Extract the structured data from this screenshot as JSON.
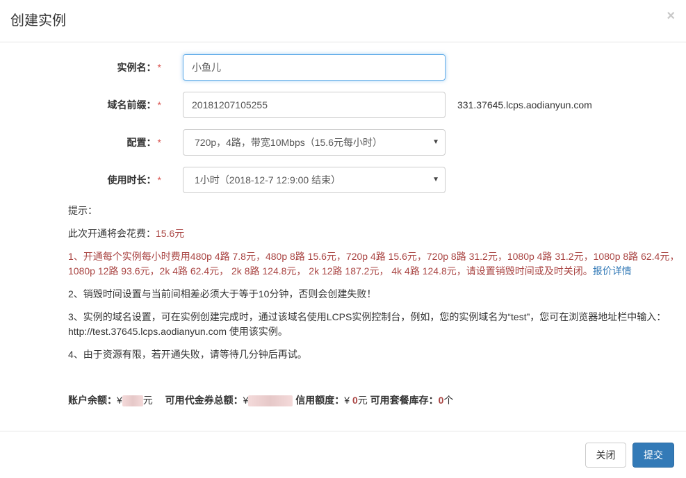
{
  "modal": {
    "title": "创建实例",
    "close_symbol": "×"
  },
  "form": {
    "name": {
      "label": "实例名",
      "colon": "：",
      "required": "*",
      "value": "小鱼儿"
    },
    "domain": {
      "label": "域名前缀",
      "colon": "：",
      "required": "*",
      "value": "20181207105255",
      "suffix": "331.37645.lcps.aodianyun.com"
    },
    "config": {
      "label": "配置",
      "colon": "：",
      "required": "*",
      "selected": "720p，4路，带宽10Mbps（15.6元每小时）"
    },
    "duration": {
      "label": "使用时长",
      "colon": "：",
      "required": "*",
      "selected": "1小时（2018-12-7 12:9:00 结束）"
    }
  },
  "tips": {
    "heading": "提示：",
    "cost_prefix": "此次开通将会花费：",
    "cost_value": "15.6元",
    "item1": "1、开通每个实例每小时费用480p 4路 7.8元，480p 8路 15.6元，720p 4路 15.6元，720p 8路 31.2元，1080p 4路 31.2元，1080p 8路 62.4元，1080p 12路 93.6元，2k 4路 62.4元， 2k 8路 124.8元， 2k 12路 187.2元， 4k 4路 124.8元，请设置销毁时间或及时关闭。",
    "item1_link": "报价详情",
    "item2": "2、销毁时间设置与当前间相差必须大于等于10分钟，否则会创建失败！",
    "item3": "3、实例的域名设置，可在实例创建完成时，通过该域名使用LCPS实例控制台，例如，您的实例域名为“test”，您可在浏览器地址栏中输入： http://test.37645.lcps.aodianyun.com 使用该实例。",
    "item4": "4、由于资源有限，若开通失败，请等待几分钟后再试。"
  },
  "account": {
    "balance_label": "账户余额：",
    "currency": "¥",
    "balance_unit": "元",
    "voucher_label": "可用代金券总额：",
    "credit_label": "信用额度：",
    "credit_value": "0",
    "credit_unit": "元",
    "package_label": "可用套餐库存：",
    "package_value": "0",
    "package_unit": "个"
  },
  "footer": {
    "close_label": "关闭",
    "submit_label": "提交"
  },
  "colors": {
    "primary": "#337ab7",
    "warning_text": "#a94442",
    "required": "#d9534f",
    "focus_border": "#66afe9"
  }
}
